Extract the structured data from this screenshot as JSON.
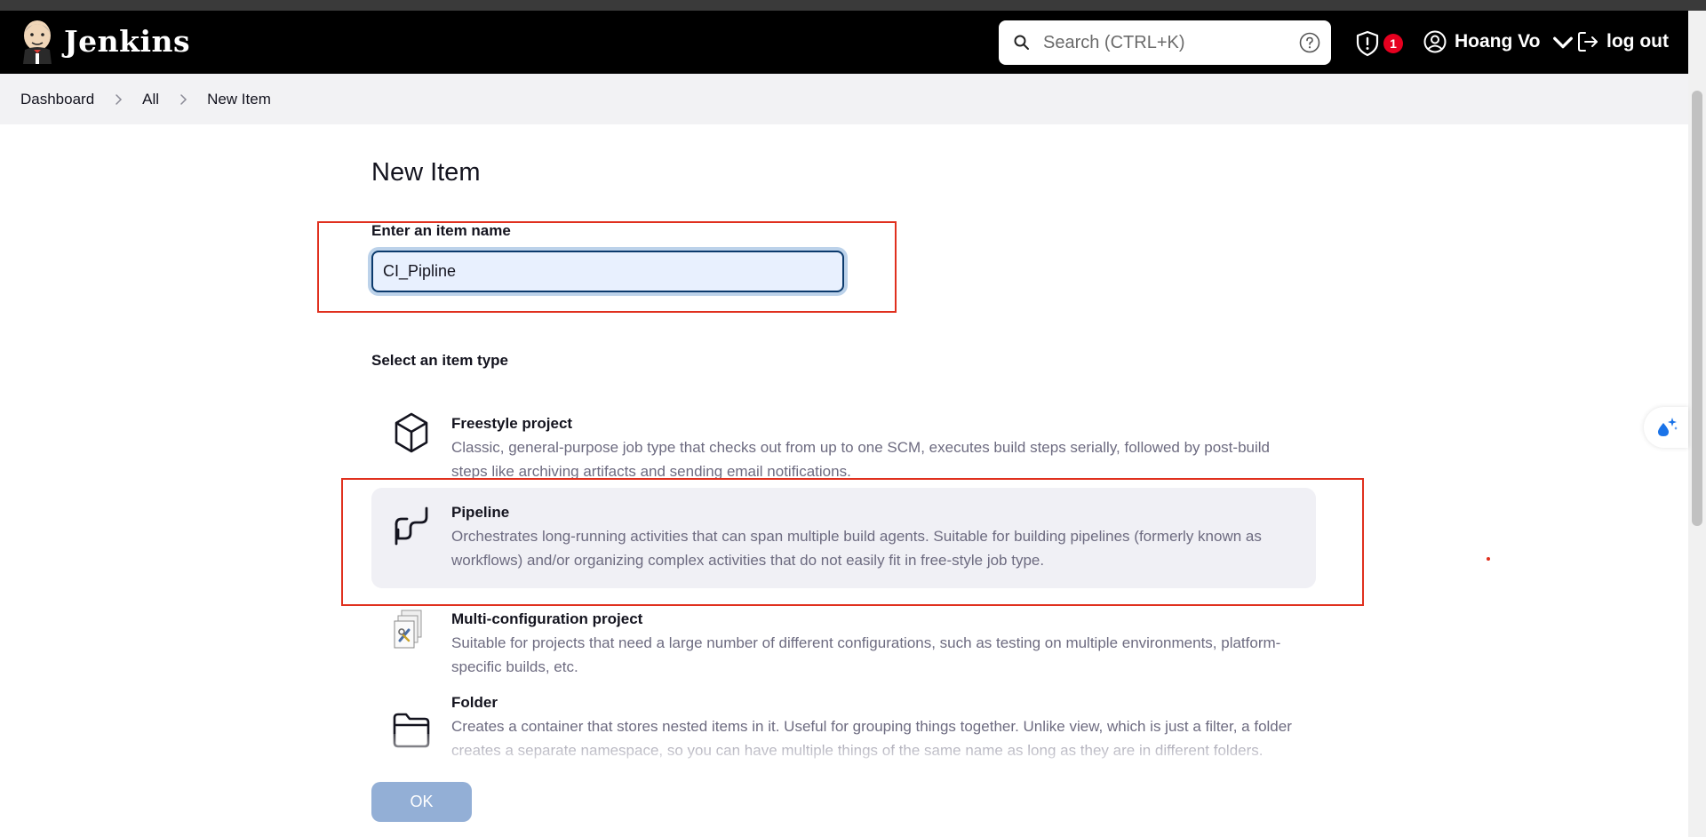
{
  "header": {
    "brand": "Jenkins",
    "search_placeholder": "Search (CTRL+K)",
    "notification_count": "1",
    "user_name": "Hoang Vo",
    "logout_label": "log out"
  },
  "breadcrumb": [
    "Dashboard",
    "All",
    "New Item"
  ],
  "main": {
    "title": "New Item",
    "name_label": "Enter an item name",
    "name_value": "CI_Pipline",
    "type_label": "Select an item type",
    "item_types": [
      {
        "title": "Freestyle project",
        "icon": "cube-icon",
        "description": "Classic, general-purpose job type that checks out from up to one SCM, executes build steps serially, followed by post-build steps like archiving artifacts and sending email notifications.",
        "selected": false
      },
      {
        "title": "Pipeline",
        "icon": "pipeline-icon",
        "description": "Orchestrates long-running activities that can span multiple build agents. Suitable for building pipelines (formerly known as workflows) and/or organizing complex activities that do not easily fit in free-style job type.",
        "selected": true
      },
      {
        "title": "Multi-configuration project",
        "icon": "multi-config-icon",
        "description": "Suitable for projects that need a large number of different configurations, such as testing on multiple environments, platform-specific builds, etc.",
        "selected": false
      },
      {
        "title": "Folder",
        "icon": "folder-icon",
        "description": "Creates a container that stores nested items in it. Useful for grouping things together. Unlike view, which is just a filter, a folder creates a separate namespace, so you can have multiple things of the same name as long as they are in different folders.",
        "selected": false
      }
    ],
    "ok_label": "OK"
  },
  "colors": {
    "header_bg": "#000000",
    "badge": "#e6001f",
    "highlight_box": "#e0301e",
    "ok_button": "#93afd6",
    "selected_item_bg": "#f0f0f5"
  }
}
